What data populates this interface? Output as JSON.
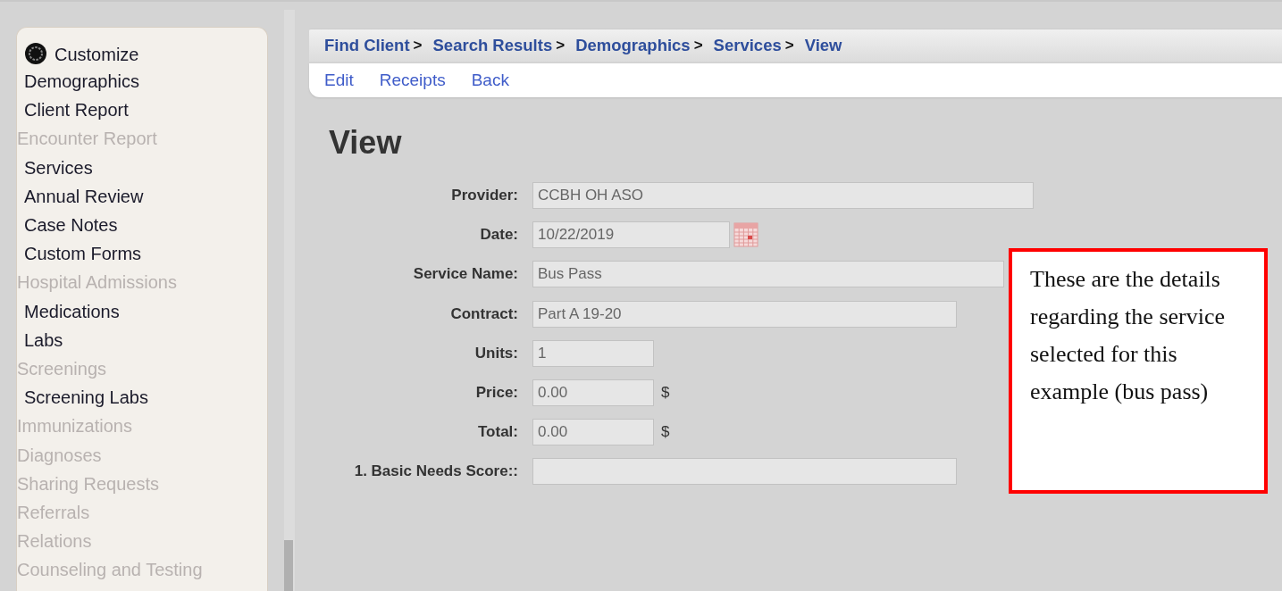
{
  "sidebar": {
    "customize": "Customize",
    "items": [
      {
        "label": "Demographics",
        "disabled": false
      },
      {
        "label": "Client Report",
        "disabled": false
      },
      {
        "label": "Encounter Report",
        "disabled": true
      },
      {
        "label": "Services",
        "disabled": false
      },
      {
        "label": "Annual Review",
        "disabled": false
      },
      {
        "label": "Case Notes",
        "disabled": false
      },
      {
        "label": "Custom Forms",
        "disabled": false
      },
      {
        "label": "Hospital Admissions",
        "disabled": true
      },
      {
        "label": "Medications",
        "disabled": false
      },
      {
        "label": "Labs",
        "disabled": false
      },
      {
        "label": "Screenings",
        "disabled": true
      },
      {
        "label": "Screening Labs",
        "disabled": false
      },
      {
        "label": "Immunizations",
        "disabled": true
      },
      {
        "label": "Diagnoses",
        "disabled": true
      },
      {
        "label": "Sharing Requests",
        "disabled": true
      },
      {
        "label": "Referrals",
        "disabled": true
      },
      {
        "label": "Relations",
        "disabled": true
      },
      {
        "label": "Counseling and Testing",
        "disabled": true
      }
    ]
  },
  "breadcrumb": [
    "Find Client",
    "Search Results",
    "Demographics",
    "Services",
    "View"
  ],
  "breadcrumb_separator": ">",
  "actions": [
    "Edit",
    "Receipts",
    "Back"
  ],
  "heading": "View",
  "fields": [
    {
      "label": "Provider:",
      "value": "CCBH OH ASO",
      "kind": "text"
    },
    {
      "label": "Date:",
      "value": "10/22/2019",
      "kind": "date"
    },
    {
      "label": "Service Name:",
      "value": "Bus Pass",
      "kind": "text"
    },
    {
      "label": "Contract:",
      "value": "Part A 19-20",
      "kind": "text"
    },
    {
      "label": "Units:",
      "value": "1",
      "kind": "text"
    },
    {
      "label": "Price:",
      "value": "0.00",
      "kind": "money",
      "unit": "$"
    },
    {
      "label": "Total:",
      "value": "0.00",
      "kind": "money",
      "unit": "$"
    },
    {
      "label": "1. Basic Needs Score::",
      "kind": "text"
    }
  ],
  "callout": "These are the details regarding the service selected for this example (bus pass)"
}
